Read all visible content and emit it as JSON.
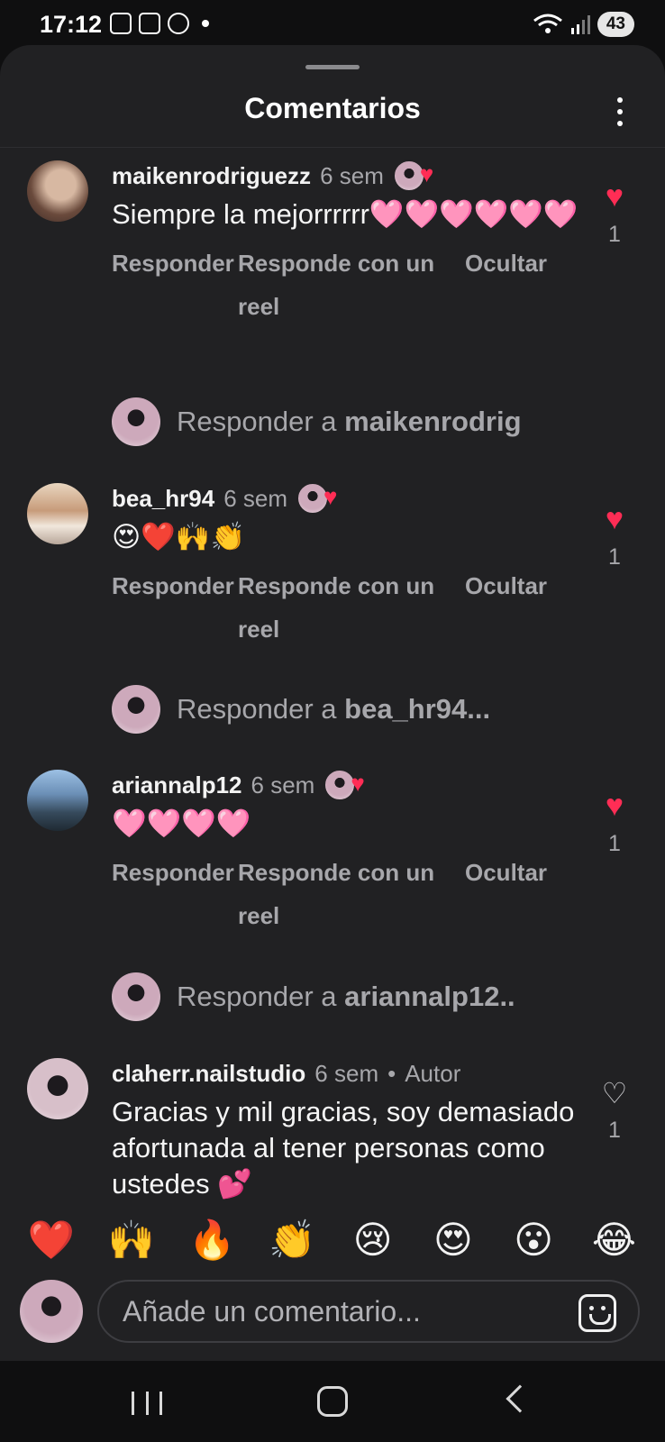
{
  "status_bar": {
    "time": "17:12",
    "battery": "43"
  },
  "sheet": {
    "title": "Comentarios"
  },
  "comments": [
    {
      "username": "maikenrodriguezz",
      "time_ago": "6 sem",
      "text": "Siempre la mejorrrrrr🩷🩷🩷🩷🩷🩷",
      "likes": "1",
      "liked": true,
      "reply_label": "Responder",
      "reel_label": "Responde con un reel",
      "hide_label": "Ocultar",
      "reply_prompt": "Responder a",
      "reply_target": "maikenrodrig"
    },
    {
      "username": "bea_hr94",
      "time_ago": "6 sem",
      "text": "😍❤️🙌👏",
      "likes": "1",
      "liked": true,
      "reply_label": "Responder",
      "reel_label": "Responde con un reel",
      "hide_label": "Ocultar",
      "reply_prompt": "Responder a",
      "reply_target": "bea_hr94..."
    },
    {
      "username": "ariannalp12",
      "time_ago": "6 sem",
      "text": "🩷🩷🩷🩷",
      "likes": "1",
      "liked": true,
      "reply_label": "Responder",
      "reel_label": "Responde con un reel",
      "hide_label": "Ocultar",
      "reply_prompt": "Responder a",
      "reply_target": "ariannalp12.."
    },
    {
      "username": "claherr.nailstudio",
      "time_ago": "6 sem",
      "author_label": "Autor",
      "text": "Gracias y mil gracias, soy demasiado afortunada al tener personas como ustedes 💕",
      "likes": "1",
      "liked": false
    }
  ],
  "emoji_bar": [
    "❤️",
    "🙌",
    "🔥",
    "👏",
    "😢",
    "😍",
    "😮",
    "😂"
  ],
  "input": {
    "placeholder": "Añade un comentario..."
  },
  "icons": {
    "more": "more-vertical-icon",
    "heart": "heart-icon",
    "sticker": "sticker-icon",
    "nav_recent": "recent-apps-icon",
    "nav_home": "home-icon",
    "nav_back": "back-icon"
  },
  "colors": {
    "like_red": "#ff2d55",
    "sheet_bg": "#212123"
  }
}
